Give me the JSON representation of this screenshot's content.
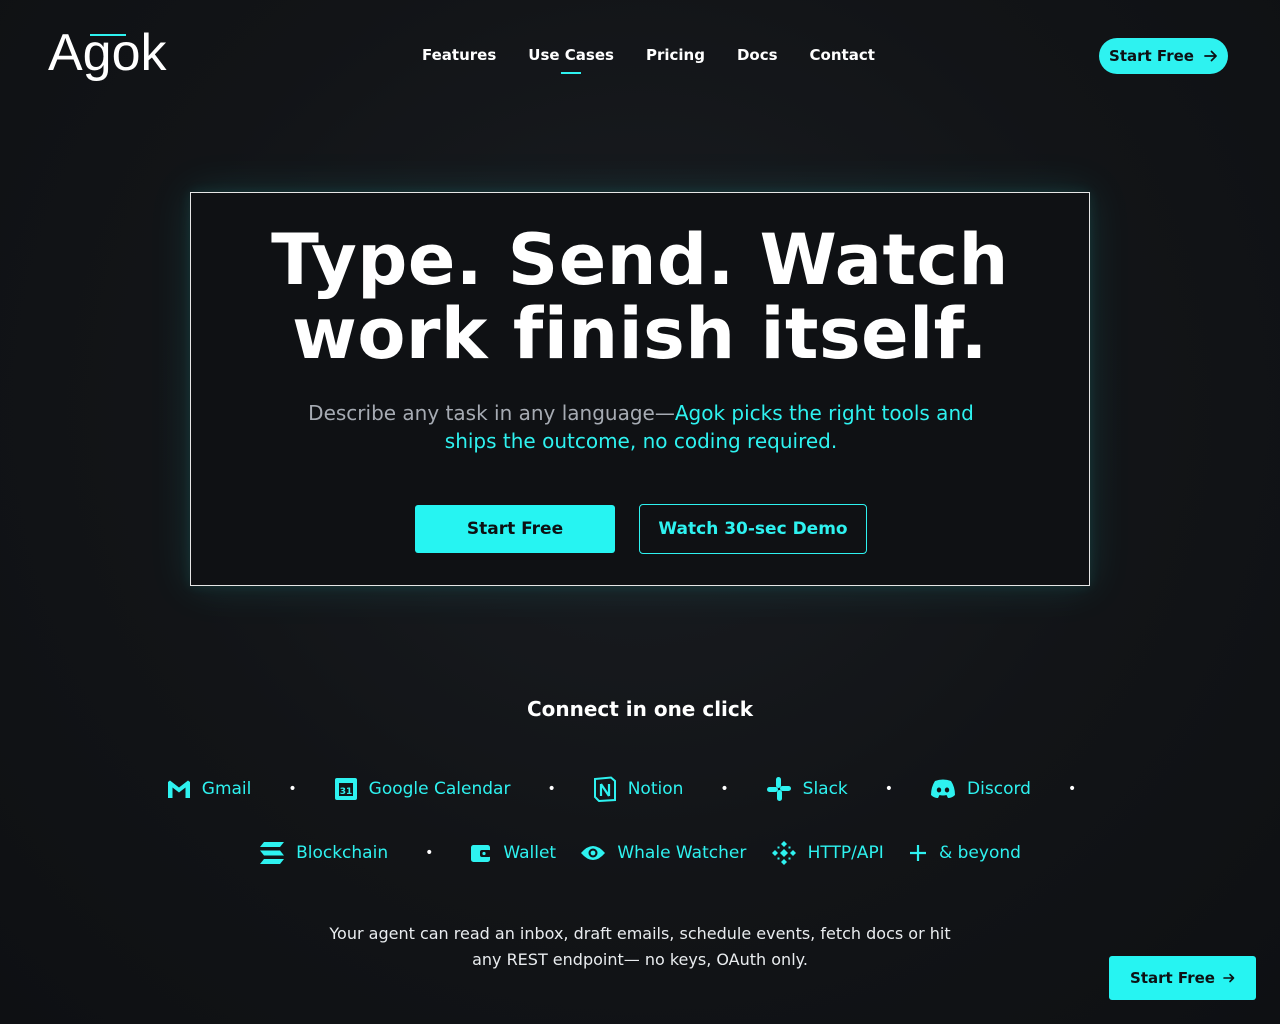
{
  "brand": {
    "name": "Agok"
  },
  "nav": {
    "links": [
      "Features",
      "Use Cases",
      "Pricing",
      "Docs",
      "Contact"
    ],
    "active": "Use Cases",
    "cta_label": "Start Free",
    "cta_icon": "arrow-right-icon"
  },
  "hero": {
    "title_line1": "Type. Send. Watch",
    "title_line2": "work finish itself.",
    "subtitle_plain": "Describe any task in any language—",
    "subtitle_accent": "Agok picks the right tools and ships the outcome, no coding required.",
    "primary_button": "Start Free",
    "secondary_button": "Watch 30-sec Demo"
  },
  "integrations": {
    "title": "Connect in one click",
    "row1": [
      {
        "label": "Gmail",
        "icon": "gmail-icon"
      },
      {
        "label": "Google Calendar",
        "icon": "calendar-icon"
      },
      {
        "label": "Notion",
        "icon": "notion-icon"
      },
      {
        "label": "Slack",
        "icon": "slack-icon"
      },
      {
        "label": "Discord",
        "icon": "discord-icon"
      }
    ],
    "row2": [
      {
        "label": "Blockchain",
        "icon": "blockchain-icon"
      },
      {
        "label": "Wallet",
        "icon": "wallet-icon"
      },
      {
        "label": "Whale Watcher",
        "icon": "eye-icon"
      },
      {
        "label": "HTTP/API",
        "icon": "api-icon"
      },
      {
        "label": "& beyond",
        "icon": "plus-icon"
      }
    ],
    "separator": "•"
  },
  "footer": {
    "text": "Your agent can read an inbox, draft emails, schedule events, fetch docs or hit any REST endpoint— no keys, OAuth only."
  },
  "floating_cta": {
    "label": "Start Free",
    "icon": "arrow-right-icon"
  },
  "colors": {
    "accent": "#2ef2f0",
    "background": "#121417",
    "text": "#ffffff",
    "muted": "#a6abb3"
  }
}
